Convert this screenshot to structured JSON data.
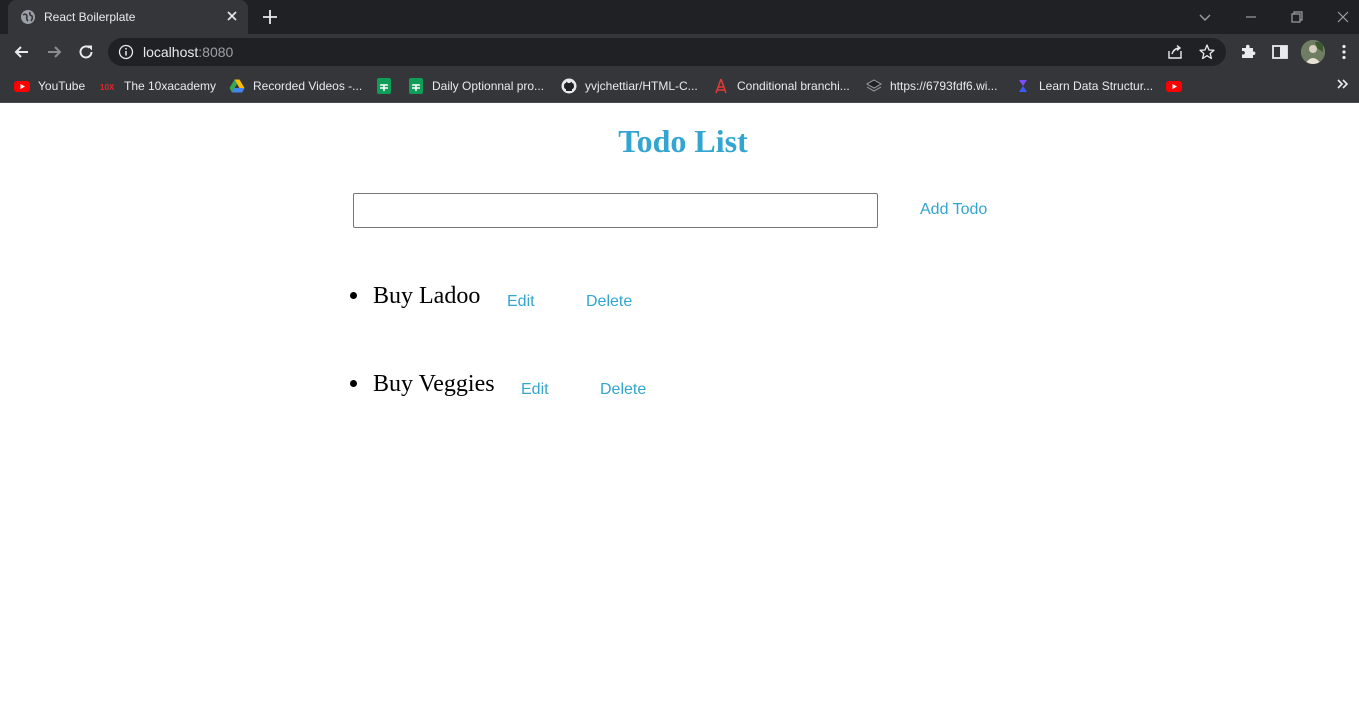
{
  "browser": {
    "tab_title": "React Boilerplate",
    "url_host": "localhost",
    "url_port": ":8080",
    "bookmarks": [
      {
        "label": "YouTube",
        "icon": "youtube-icon"
      },
      {
        "label": "The 10xacademy",
        "icon": "10x-icon"
      },
      {
        "label": "Recorded Videos -...",
        "icon": "drive-icon"
      },
      {
        "label": "",
        "icon": "sheets-icon"
      },
      {
        "label": "Daily Optionnal pro...",
        "icon": "sheets-icon"
      },
      {
        "label": "yvjchettiar/HTML-C...",
        "icon": "github-icon"
      },
      {
        "label": "Conditional branchi...",
        "icon": "tower-icon"
      },
      {
        "label": "https://6793fdf6.wi...",
        "icon": "layers-icon"
      },
      {
        "label": "Learn Data Structur...",
        "icon": "course-icon"
      },
      {
        "label": "",
        "icon": "youtube-icon"
      }
    ]
  },
  "app": {
    "title": "Todo List",
    "input_value": "",
    "add_label": "Add Todo",
    "todos": [
      {
        "text": "Buy Ladoo",
        "edit_label": "Edit",
        "delete_label": "Delete"
      },
      {
        "text": "Buy Veggies",
        "edit_label": "Edit",
        "delete_label": "Delete"
      }
    ]
  },
  "colors": {
    "accent": "#33a5d0",
    "chrome_dark": "#202124",
    "chrome_toolbar": "#35363a"
  }
}
